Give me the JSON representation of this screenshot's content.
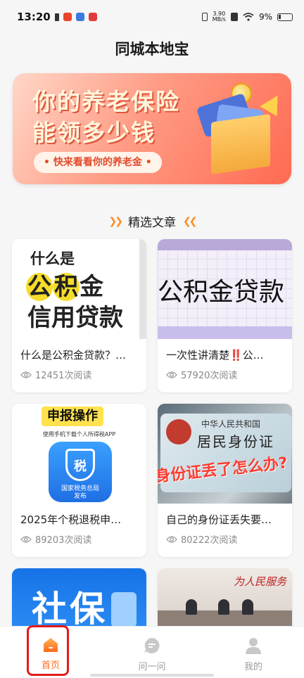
{
  "status_bar": {
    "time": "13:20",
    "net_speed_value": "3.90",
    "net_speed_unit": "MB/s",
    "battery": "9%"
  },
  "app": {
    "title": "同城本地宝"
  },
  "banner": {
    "line1": "你的养老保险",
    "line2": "能领多少钱",
    "cta": "• 快来看看你的养老金 •"
  },
  "section": {
    "title": "精选文章",
    "arrows_left": "❯❯",
    "arrows_right": "❮❮"
  },
  "articles": [
    {
      "title": "什么是公积金贷款？…",
      "reads": "12451次阅读",
      "thumb": {
        "line1": "什么是",
        "line2a": "公",
        "line2b": "积",
        "line2c": "金",
        "line3": "信用贷款"
      }
    },
    {
      "title": "一次性讲清楚‼️公…",
      "reads": "57920次阅读",
      "thumb": {
        "big": "公积金贷款"
      }
    },
    {
      "title": "2025年个税退税申…",
      "reads": "89203次阅读",
      "thumb": {
        "pill": "申报操作",
        "sub": "使用手机下载个人所得税APP",
        "glyph": "税",
        "cap": "国家税务总局\n发布"
      }
    },
    {
      "title": "自己的身份证丢失要…",
      "reads": "80222次阅读",
      "thumb": {
        "cn1": "中华人民共和国",
        "cn2": "居民身份证",
        "scrawl": "身份证丢了怎么办?"
      }
    },
    {
      "thumb": {
        "big": "社保"
      }
    },
    {
      "thumb": {
        "sign": "为人民服务"
      }
    }
  ],
  "tabs": [
    {
      "label": "首页",
      "icon": "home-icon",
      "active": true
    },
    {
      "label": "问一问",
      "icon": "chat-icon",
      "active": false
    },
    {
      "label": "我的",
      "icon": "user-icon",
      "active": false
    }
  ],
  "colors": {
    "accent": "#ff6a1a",
    "highlight_box": "#e21b1b"
  }
}
